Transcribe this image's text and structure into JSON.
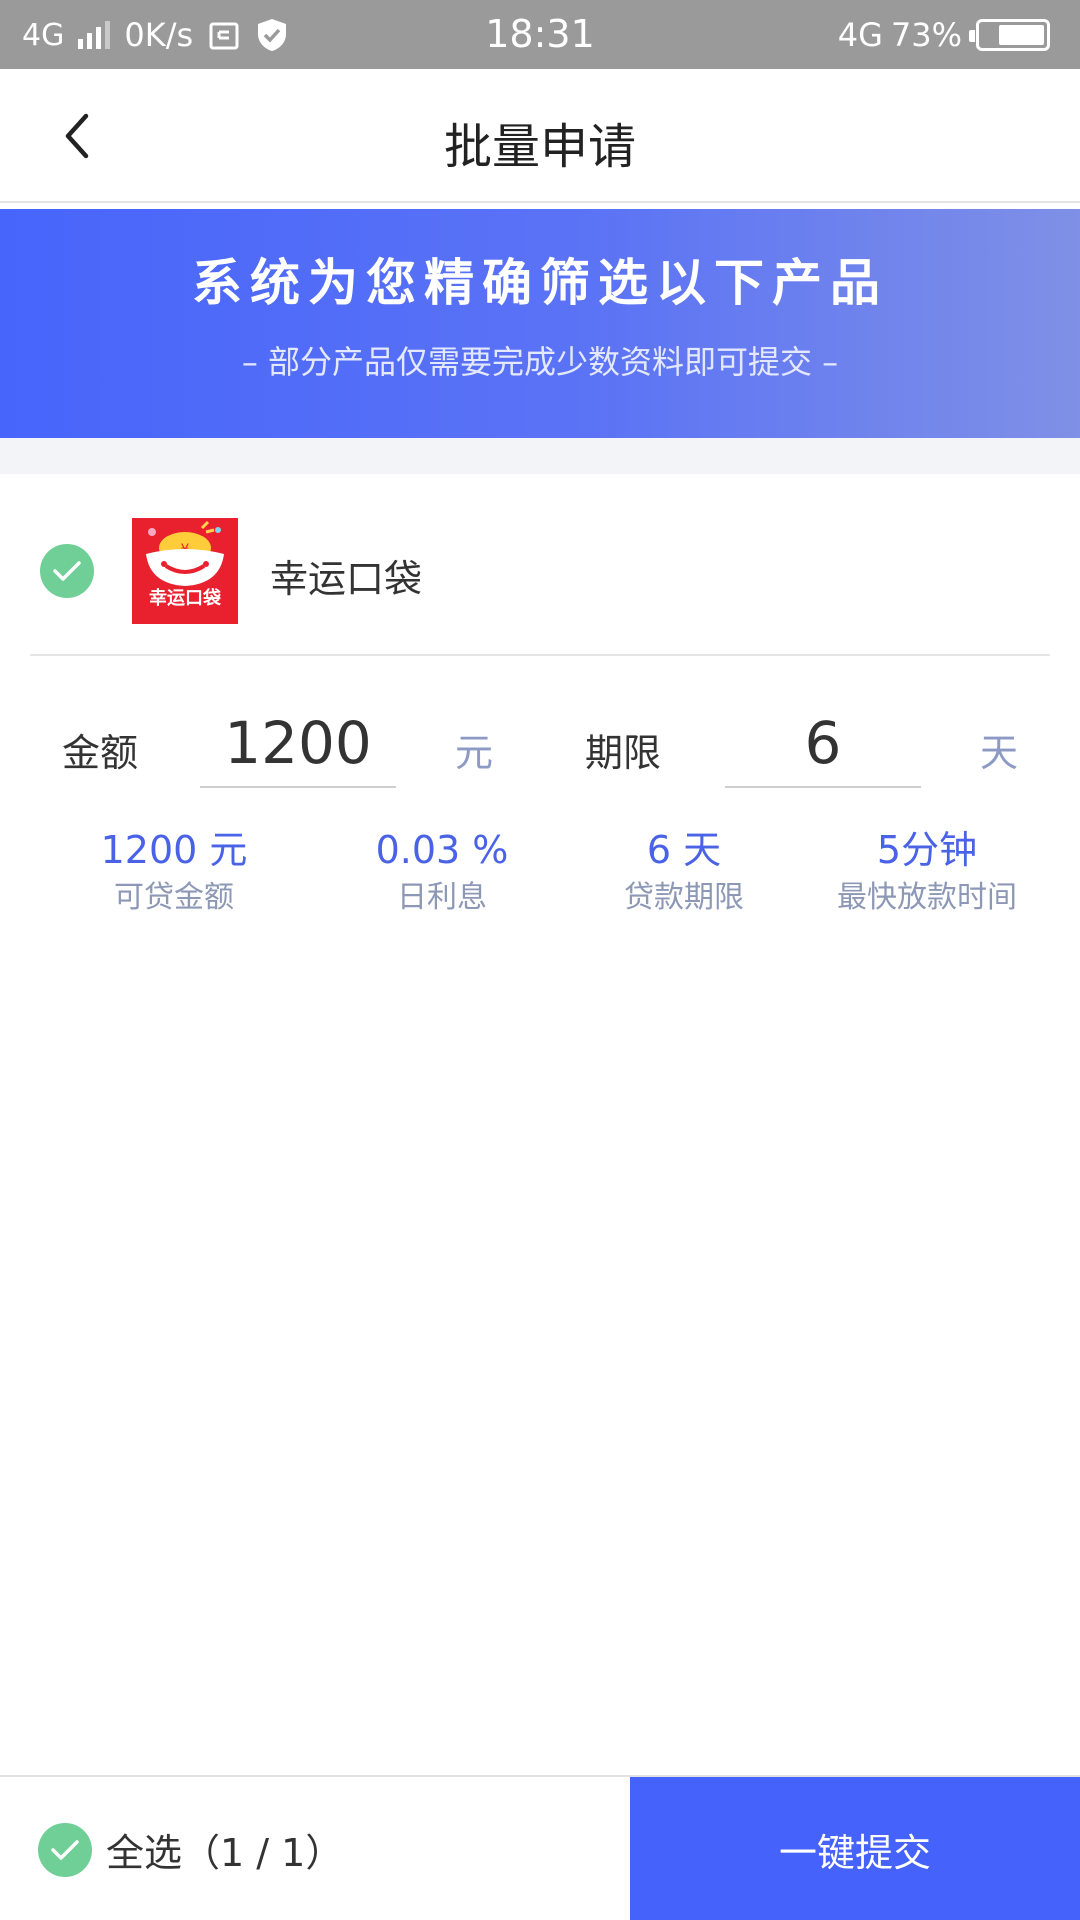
{
  "status_bar": {
    "network": "4G",
    "speed": "0K/s",
    "time": "18:31",
    "network_right": "4G",
    "battery": "73%",
    "battery_level": 0.73
  },
  "header": {
    "title": "批量申请"
  },
  "banner": {
    "title": "系统为您精确筛选以下产品",
    "subtitle": "– 部分产品仅需要完成少数资料即可提交 –"
  },
  "product": {
    "name": "幸运口袋",
    "logo_text": "幸运口袋",
    "checked": true
  },
  "form": {
    "amount_label": "金额",
    "amount_value": "1200",
    "amount_unit": "元",
    "term_label": "期限",
    "term_value": "6",
    "term_unit": "天"
  },
  "stats": [
    {
      "value": "1200 元",
      "label": "可贷金额"
    },
    {
      "value": "0.03 %",
      "label": "日利息"
    },
    {
      "value": "6 天",
      "label": "贷款期限"
    },
    {
      "value": "5分钟",
      "label": "最快放款时间"
    }
  ],
  "footer": {
    "select_all": "全选（1 / 1）",
    "submit": "一键提交"
  },
  "colors": {
    "accent": "#4562fb",
    "check": "#6fcf97",
    "status_bar": "#9a9a9a",
    "logo_bg": "#e9202e"
  }
}
